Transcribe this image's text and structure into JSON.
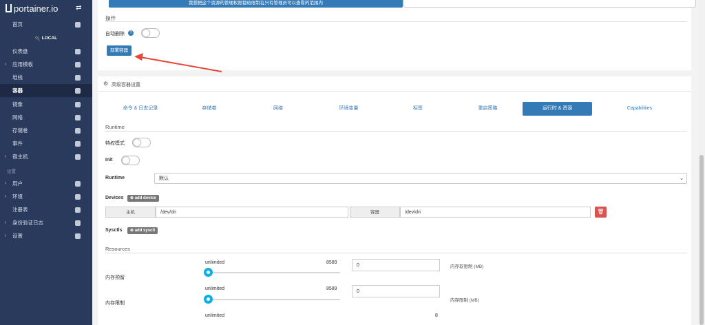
{
  "app": {
    "brand": "portainer.io"
  },
  "sidebar": {
    "environment": "LOCAL",
    "settings_heading": "设置",
    "items": [
      {
        "label": "首页",
        "icon": "home-icon"
      },
      {
        "label": "仪表盘",
        "icon": "tachometer-icon"
      },
      {
        "label": "应用模板",
        "icon": "rocket-icon"
      },
      {
        "label": "堆栈",
        "icon": "th-list-icon"
      },
      {
        "label": "容器",
        "icon": "cubes-icon"
      },
      {
        "label": "镜像",
        "icon": "clone-icon"
      },
      {
        "label": "网络",
        "icon": "sitemap-icon"
      },
      {
        "label": "存储卷",
        "icon": "hdd-icon"
      },
      {
        "label": "事件",
        "icon": "history-icon"
      },
      {
        "label": "宿主机",
        "icon": "th-icon"
      },
      {
        "label": "用户",
        "icon": "users-icon"
      },
      {
        "label": "环境",
        "icon": "plug-icon"
      },
      {
        "label": "注册表",
        "icon": "database-icon"
      },
      {
        "label": "身份验证日志",
        "icon": "history-icon"
      },
      {
        "label": "设置",
        "icon": "cogs-icon"
      }
    ]
  },
  "top": {
    "banner": "我想把这个资源的管理权限都给限制在只有管理员可以查看的范围内"
  },
  "actions": {
    "title": "操作",
    "auto_remove_label": "自动删除",
    "deploy_label": "部署容器"
  },
  "advanced": {
    "title": "高级容器设置",
    "tabs": [
      "命令 & 日志记录",
      "存储卷",
      "网络",
      "环境变量",
      "标签",
      "重启策略",
      "运行时 & 资源",
      "Capabilities"
    ],
    "active_tab": "运行时 & 资源"
  },
  "runtime": {
    "section_title": "Runtime",
    "privileged_label": "特权模式",
    "init_label": "Init",
    "runtime_label": "Runtime",
    "runtime_value": "默认",
    "devices_label": "Devices",
    "add_device": "add device",
    "host_addon": "主机",
    "host_value": "/dev/dri",
    "container_addon": "容器",
    "container_value": "/dev/dri",
    "sysctls_label": "Sysctls",
    "add_sysctl": "add sysctl"
  },
  "resources": {
    "section_title": "Resources",
    "rows": [
      {
        "label": "内存预留",
        "min_text": "unlimited",
        "max_text": "8589",
        "value": "0",
        "note": "内存软限制 (MB)",
        "fraction": 0.0
      },
      {
        "label": "内存限制",
        "min_text": "unlimited",
        "max_text": "8589",
        "value": "0",
        "note": "内存限制 (MB)",
        "fraction": 0.0
      },
      {
        "label": "",
        "min_text": "unlimited",
        "max_text": "8",
        "value": "",
        "note": "",
        "fraction": 0.0
      }
    ]
  },
  "colors": {
    "sidebar": "#2a3a5d",
    "primary": "#337ab7",
    "danger": "#d9534f",
    "slider": "#0bb0e8",
    "arrow": "#e8473b"
  }
}
